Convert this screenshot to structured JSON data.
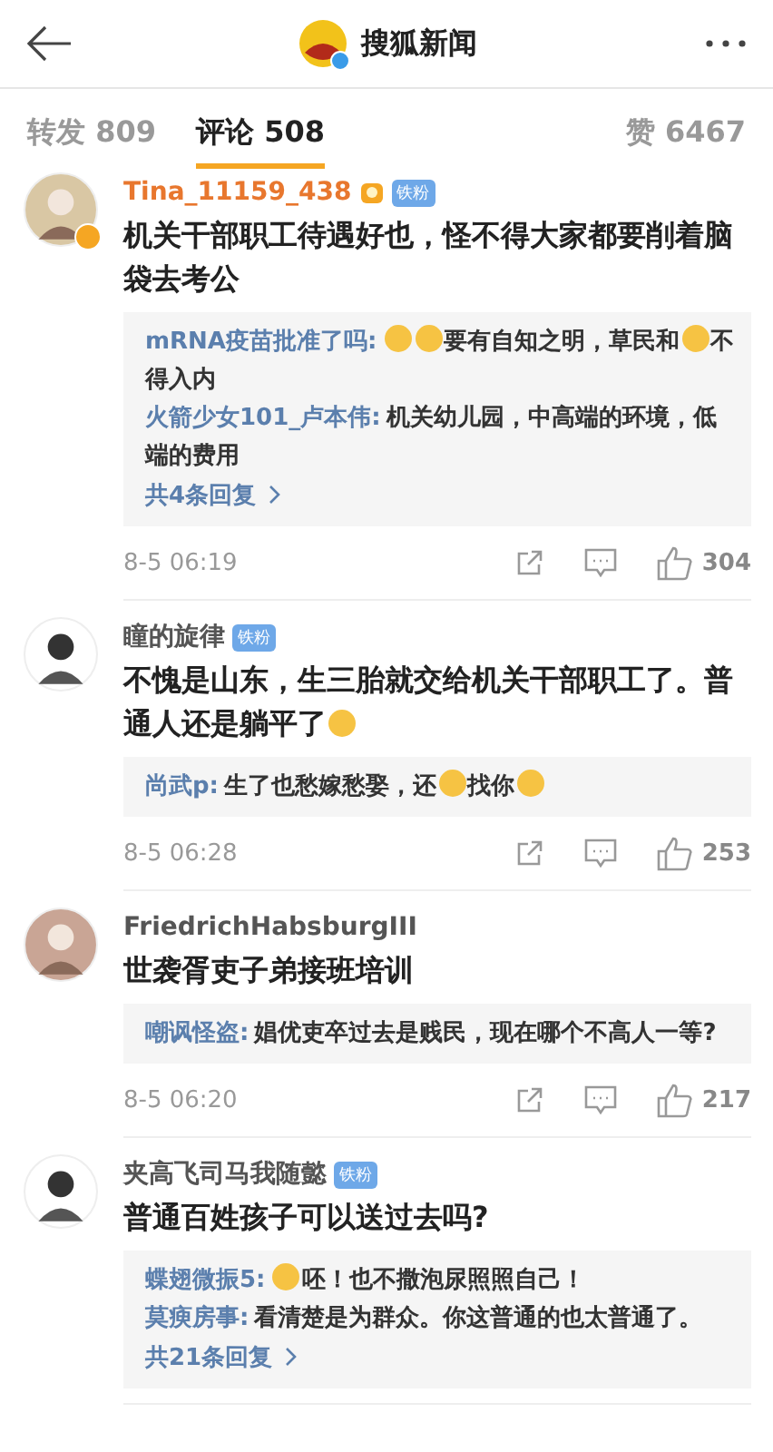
{
  "header": {
    "title": "搜狐新闻",
    "verified": true
  },
  "tabs": [
    {
      "label": "转发",
      "count": "809",
      "selected": false
    },
    {
      "label": "评论",
      "count": "508",
      "selected": true
    },
    {
      "label": "赞",
      "count": "6467",
      "selected": false
    }
  ],
  "comments": [
    {
      "avatar": {
        "kind": "picture"
      },
      "verified": true,
      "name": "Tina_11159_438",
      "name_highlight": true,
      "medal": true,
      "badge": "铁粉",
      "text": [
        {
          "kind": "text",
          "text": "机关干部职工待遇好也，怪不得大家都要削着脑袋去考公"
        }
      ],
      "replies": [
        {
          "user": "mRNA疫苗批准了吗:",
          "parts": [
            {
              "kind": "emoji"
            },
            {
              "kind": "emoji"
            },
            {
              "kind": "text",
              "text": "要有自知之明，草民和"
            },
            {
              "kind": "emoji"
            },
            {
              "kind": "text",
              "text": "不得入内"
            }
          ]
        },
        {
          "user": "火箭少女101_卢本伟:",
          "parts": [
            {
              "kind": "text",
              "text": "机关幼儿园，中高端的环境，低端的费用"
            }
          ]
        }
      ],
      "more": "共4条回复",
      "time": "8-5 06:19",
      "likes": "304"
    },
    {
      "avatar": {
        "kind": "picture"
      },
      "verified": false,
      "name": "瞳的旋律",
      "name_highlight": false,
      "medal": false,
      "badge": "铁粉",
      "text": [
        {
          "kind": "text",
          "text": "不愧是山东，生三胎就交给机关干部职工了。普通人还是躺平了"
        },
        {
          "kind": "emoji"
        }
      ],
      "replies": [
        {
          "user": "尚武p:",
          "parts": [
            {
              "kind": "text",
              "text": "生了也愁嫁愁娶，还"
            },
            {
              "kind": "emoji"
            },
            {
              "kind": "text",
              "text": "找你"
            },
            {
              "kind": "emoji"
            }
          ]
        }
      ],
      "time": "8-5 06:28",
      "likes": "253"
    },
    {
      "avatar": {
        "kind": "picture"
      },
      "verified": false,
      "name": "FriedrichHabsburgIII",
      "name_highlight": false,
      "medal": false,
      "text": [
        {
          "kind": "text",
          "text": "世袭胥吏子弟接班培训"
        }
      ],
      "replies": [
        {
          "user": "嘲讽怪盗:",
          "parts": [
            {
              "kind": "text",
              "text": "娼优吏卒过去是贱民，现在哪个不高人一等?"
            }
          ]
        }
      ],
      "time": "8-5 06:20",
      "likes": "217"
    },
    {
      "avatar": {
        "kind": "picture"
      },
      "verified": false,
      "name": "夹高飞司马我随懿",
      "name_highlight": false,
      "medal": false,
      "badge": "铁粉",
      "text": [
        {
          "kind": "text",
          "text": "普通百姓孩子可以送过去吗?"
        }
      ],
      "replies": [
        {
          "user": "蝶翅微振5:",
          "parts": [
            {
              "kind": "emoji"
            },
            {
              "kind": "text",
              "text": "呸！也不撒泡尿照照自己！"
            }
          ]
        },
        {
          "user": "莫瘐房事:",
          "parts": [
            {
              "kind": "text",
              "text": "看清楚是为群众。你这普通的也太普通了。"
            }
          ]
        }
      ],
      "more": "共21条回复"
    }
  ]
}
